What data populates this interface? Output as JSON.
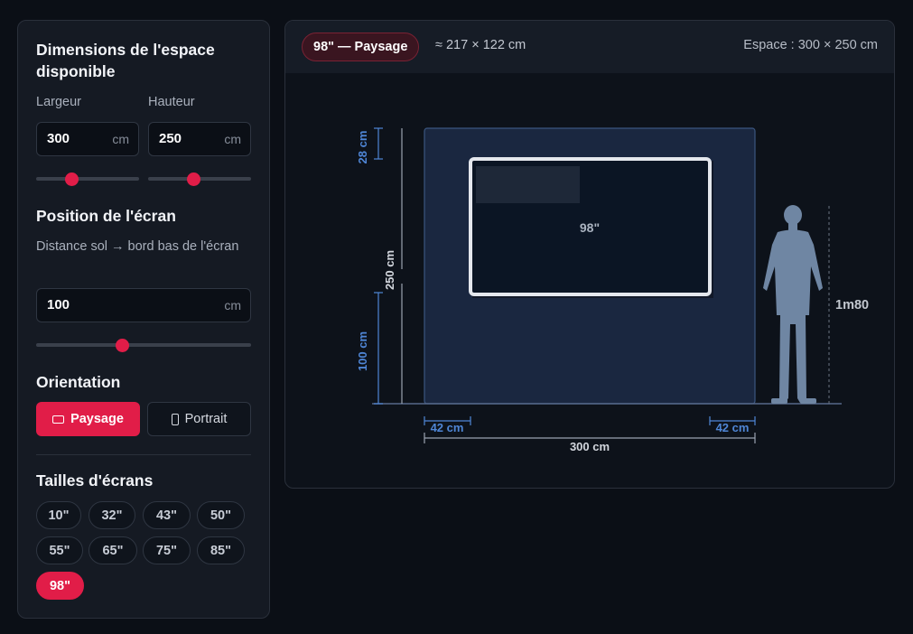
{
  "sidebar": {
    "dimensions_title": "Dimensions de l'espace disponible",
    "width_label": "Largeur",
    "height_label": "Hauteur",
    "width_value": "300",
    "height_value": "250",
    "unit": "cm",
    "width_slider_fraction": 0.35,
    "height_slider_fraction": 0.44,
    "position_title": "Position de l'écran",
    "distance_label": "Distance sol → bord bas de l'écran",
    "distance_value": "100",
    "distance_slider_fraction": 0.4,
    "orientation_title": "Orientation",
    "orientation_landscape": "Paysage",
    "orientation_portrait": "Portrait",
    "orientation_selected": "Paysage",
    "sizes_title": "Tailles d'écrans",
    "sizes": [
      "10\"",
      "32\"",
      "43\"",
      "50\"",
      "55\"",
      "65\"",
      "75\"",
      "85\"",
      "98\""
    ],
    "selected_size": "98\""
  },
  "preview": {
    "badge": "98\" — Paysage",
    "screen_size": "≈ 217 × 122 cm",
    "space_label": "Espace : 300 × 250 cm",
    "diagram": {
      "screen_label": "98\"",
      "top_gap": "28 cm",
      "space_height": "250 cm",
      "floor_gap": "100 cm",
      "left_gap": "42 cm",
      "right_gap": "42 cm",
      "space_width": "300 cm",
      "person_height": "1m80"
    }
  },
  "colors": {
    "accent": "#e11d48",
    "dimension_blue": "#4f86d6",
    "wall": "#1a2740",
    "person": "#6f86a3"
  },
  "icons": [
    "landscape-icon",
    "portrait-icon",
    "person-silhouette-icon"
  ]
}
